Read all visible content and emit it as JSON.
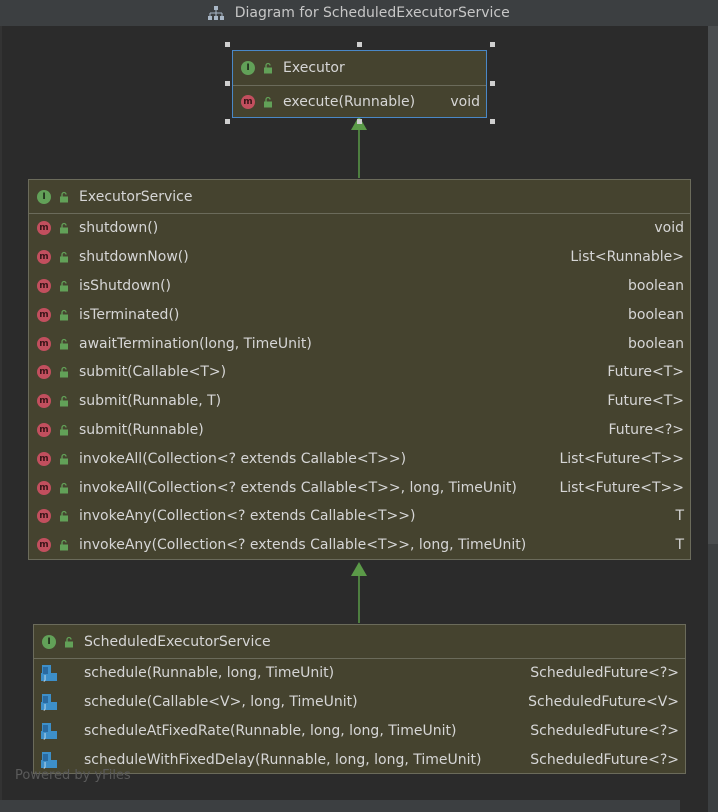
{
  "window": {
    "title": "Diagram for ScheduledExecutorService"
  },
  "colors": {
    "node_bg": "#45432f",
    "node_border": "#6b6b5b",
    "selection": "#4a88c7",
    "edge": "#5b9a48",
    "interface_badge": "#62a158",
    "method_badge": "#c24f5e",
    "static_icon": "#3d8fc9"
  },
  "nodes": {
    "executor": {
      "name": "Executor",
      "kind": "interface",
      "methods": [
        {
          "name": "execute(Runnable)",
          "ret": "void"
        }
      ]
    },
    "executor_service": {
      "name": "ExecutorService",
      "kind": "interface",
      "methods": [
        {
          "name": "shutdown()",
          "ret": "void"
        },
        {
          "name": "shutdownNow()",
          "ret": "List<Runnable>"
        },
        {
          "name": "isShutdown()",
          "ret": "boolean"
        },
        {
          "name": "isTerminated()",
          "ret": "boolean"
        },
        {
          "name": "awaitTermination(long, TimeUnit)",
          "ret": "boolean"
        },
        {
          "name": "submit(Callable<T>)",
          "ret": "Future<T>"
        },
        {
          "name": "submit(Runnable, T)",
          "ret": "Future<T>"
        },
        {
          "name": "submit(Runnable)",
          "ret": "Future<?>"
        },
        {
          "name": "invokeAll(Collection<? extends Callable<T>>)",
          "ret": "List<Future<T>>"
        },
        {
          "name": "invokeAll(Collection<? extends Callable<T>>, long, TimeUnit)",
          "ret": "List<Future<T>>"
        },
        {
          "name": "invokeAny(Collection<? extends Callable<T>>)",
          "ret": "T"
        },
        {
          "name": "invokeAny(Collection<? extends Callable<T>>, long, TimeUnit)",
          "ret": "T"
        }
      ]
    },
    "scheduled_executor_service": {
      "name": "ScheduledExecutorService",
      "kind": "interface",
      "methods": [
        {
          "name": "schedule(Runnable, long, TimeUnit)",
          "ret": "ScheduledFuture<?>"
        },
        {
          "name": "schedule(Callable<V>, long, TimeUnit)",
          "ret": "ScheduledFuture<V>"
        },
        {
          "name": "scheduleAtFixedRate(Runnable, long, long, TimeUnit)",
          "ret": "ScheduledFuture<?>"
        },
        {
          "name": "scheduleWithFixedDelay(Runnable, long, long, TimeUnit)",
          "ret": "ScheduledFuture<?>"
        }
      ]
    }
  },
  "icons": {
    "interface": "interface-icon",
    "method": "method-icon",
    "public": "unlock-icon",
    "abstract_method": "abstract-method-icon",
    "diagram": "hierarchy-icon"
  },
  "footer": {
    "watermark": "Powered by yFiles"
  }
}
